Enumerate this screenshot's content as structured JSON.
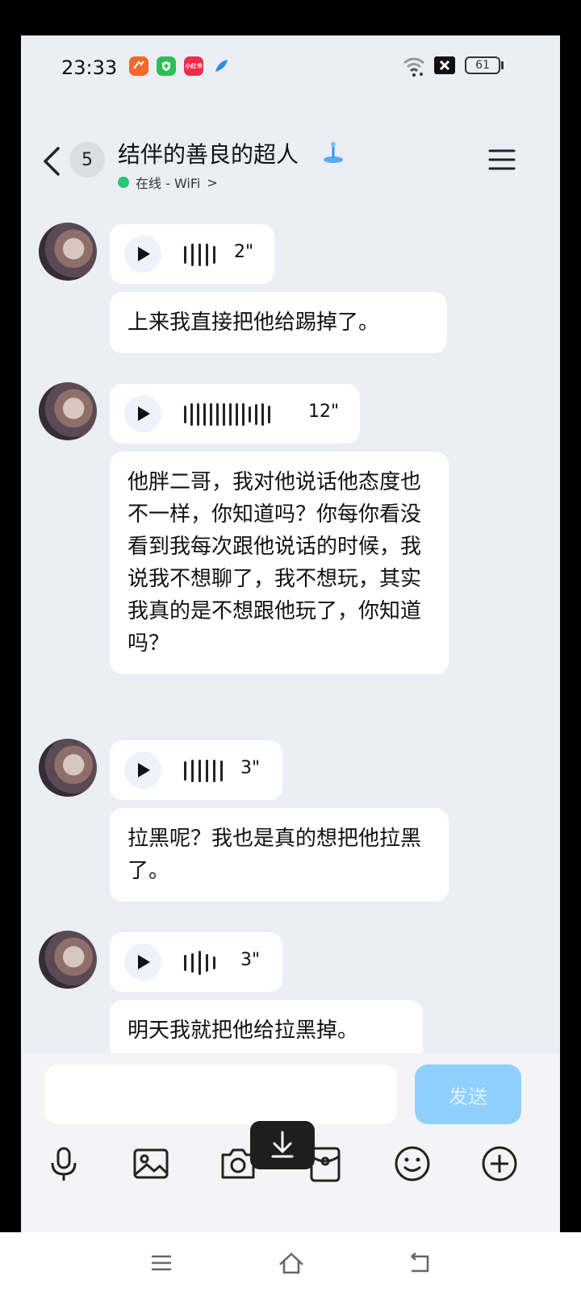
{
  "status_bar": {
    "time": "23:33",
    "apps": [
      "weibo-app-icon",
      "phone-manager-app-icon",
      "xiaohongshu-app-icon",
      "feather-app-icon"
    ],
    "xiaohongshu_label": "小红书",
    "battery": "61"
  },
  "header": {
    "unread_count": "5",
    "title": "结伴的善良的超人",
    "status": "在线 - WiFi",
    "status_chevron": ">"
  },
  "messages": [
    {
      "type": "voice",
      "duration": "2\""
    },
    {
      "type": "text",
      "text": "上来我直接把他给踢掉了。"
    },
    {
      "type": "voice",
      "duration": "12\""
    },
    {
      "type": "text",
      "text": "他胖二哥，我对他说话他态度也不一样，你知道吗？你每你看没看到我每次跟他说话的时候，我说我不想聊了，我不想玩，其实我真的是不想跟他玩了，你知道吗？"
    },
    {
      "type": "voice",
      "duration": "3\""
    },
    {
      "type": "text",
      "text": "拉黑呢？我也是真的想把他拉黑了。"
    },
    {
      "type": "voice",
      "duration": "3\""
    },
    {
      "type": "text",
      "text": "明天我就把他给拉黑掉。"
    }
  ],
  "input": {
    "value": "",
    "send_label": "发送"
  },
  "colors": {
    "background": "#eceef5",
    "send_button": "#8fd0ff",
    "online_dot": "#29c57a"
  }
}
